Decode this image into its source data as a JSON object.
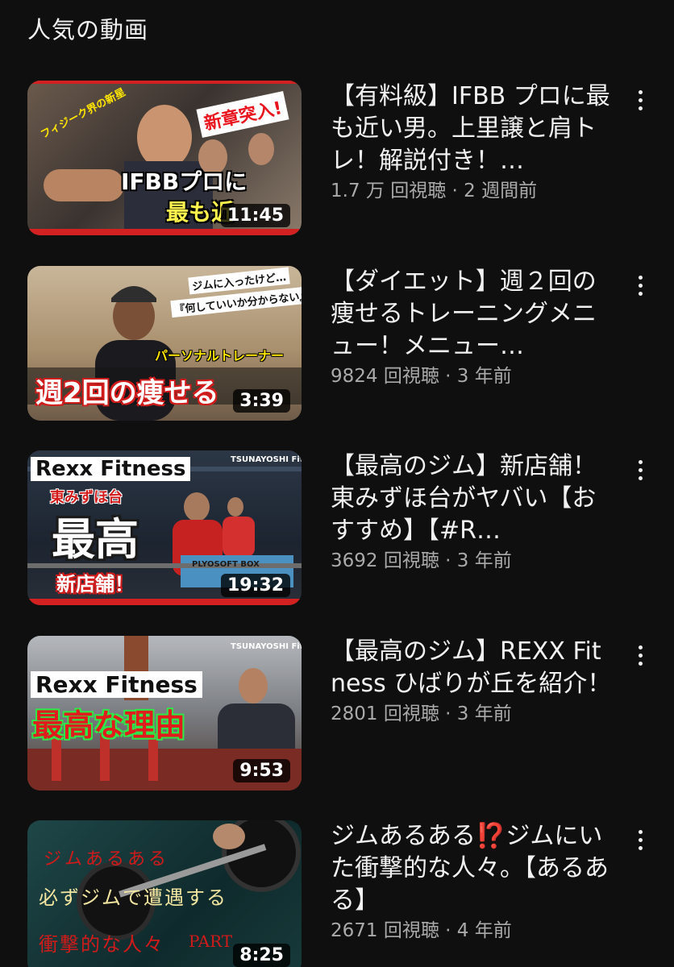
{
  "section": {
    "title": "人気の動画"
  },
  "videos": [
    {
      "title": "【有料級】IFBB プロに最も近い男。上里譲と肩トレ！解説付き！…",
      "stats": "1.7 万 回視聴 · 2 週間前",
      "duration": "11:45",
      "thumb_texts": {
        "a": "新章突入!",
        "b": "IFBBプロに",
        "c": "最も近",
        "d": "フィジーク界の新星"
      }
    },
    {
      "title": "【ダイエット】週２回の痩せるトレーニングメニュー！メニュー…",
      "stats": "9824 回視聴 · 3 年前",
      "duration": "3:39",
      "thumb_texts": {
        "a": "ジムに入ったけど…",
        "b": "『何していいか分からない』",
        "c": "パーソナルトレーナー",
        "d": "週2回の痩せる"
      }
    },
    {
      "title": "【最高のジム】新店舗！東みずほ台がヤバい【おすすめ】【#R…",
      "stats": "3692 回視聴 · 3 年前",
      "duration": "19:32",
      "thumb_texts": {
        "a": "Rexx Fitness",
        "b": "東みずほ台",
        "c": "最高",
        "d": "新店舗！",
        "e": "TSUNAYOSHI Fitness",
        "f": "PLYOSOFT BOX"
      }
    },
    {
      "title": "【最高のジム】REXX Fitness ひばりが丘を紹介！",
      "stats": "2801 回視聴 · 3 年前",
      "duration": "9:53",
      "thumb_texts": {
        "a": "Rexx Fitness",
        "b": "最高な理由",
        "e": "TSUNAYOSHI Fitness"
      }
    },
    {
      "title": "ジムあるある⁉️ジムにいた衝撃的な人々。【あるある】",
      "stats": "2671 回視聴 · 4 年前",
      "duration": "8:25",
      "thumb_texts": {
        "a": "ジムあるある",
        "b": "必ずジムで遭遇する",
        "c": "衝撃的な人々",
        "d": "PART"
      }
    }
  ],
  "colors": {
    "background": "#0f0f0f",
    "text": "#f1f1f1",
    "secondary": "#aaaaaa"
  }
}
